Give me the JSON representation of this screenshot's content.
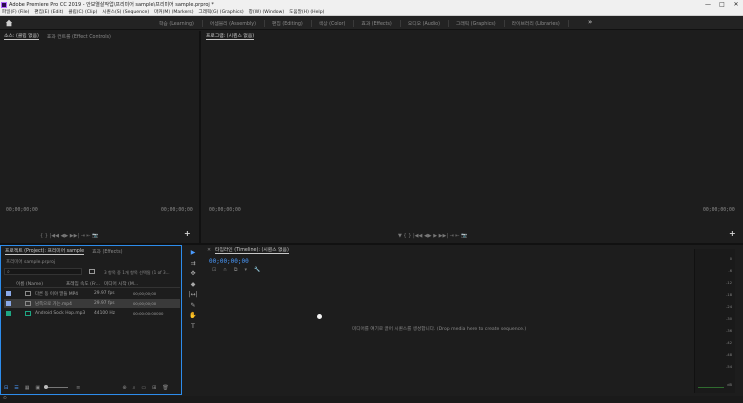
{
  "window": {
    "title": "Adobe Premiere Pro CC 2019 - 안보열살작업\\프리미어 sample\\프리미어 sample.prproj *",
    "controls": [
      "—",
      "□",
      "✕"
    ]
  },
  "menu": [
    "파일(F) (File)",
    "편집(E) (Edit)",
    "클립(C) (Clip)",
    "시퀀스(S) (Sequence)",
    "마커(M) (Markers)",
    "그래픽(G) (Graphics)",
    "창(W) (Window)",
    "도움말(H) (Help)"
  ],
  "workspaces": [
    "학습 (Learning)",
    "어셈블리 (Assembly)",
    "편집 (Editing)",
    "색상 (Color)",
    "효과 (Effects)",
    "오디오 (Audio)",
    "그래픽 (Graphics)",
    "라이브러리 (Libraries)"
  ],
  "workspaces_more": "»",
  "source_panel": {
    "tabs": [
      "소스: (클립 없음)",
      "효과 컨트롤 (Effect Controls)"
    ],
    "timecode_left": "00;00;00;00",
    "timecode_right": "00;00;00;00",
    "fit": "",
    "controls": "{    }    |◀◀  ◀▶  ▶▶|  ⇥   ⇤   📷"
  },
  "program_panel": {
    "tabs": [
      "프로그램: (시퀀스 없음)"
    ],
    "timecode_left": "00;00;00;00",
    "timecode_right": "00;00;00;00",
    "controls": "▼   {    }    |◀◀  ◀▶   ▶   ▶▶|   ⇥   ⇤   📷"
  },
  "project_panel": {
    "tabs": [
      "프로젝트 (Project): 프리미어 sample",
      "효과 (Effects)"
    ],
    "file": "프리미어 sample.prproj",
    "search_placeholder": "",
    "item_count": "3 항목 중 1개 항목 선택됨 (1 of 3...",
    "columns": [
      "이름 (Name)",
      "프레임 속도 (Fr...",
      "미디어 시작 (M..."
    ],
    "rows": [
      {
        "name": "다른 동 이야 말들 MP4",
        "fps": "29.97 fps",
        "start": "00;00;00;00",
        "color": "#8aa9e8",
        "selected": false
      },
      {
        "name": "남쪽으로 가는.mp4",
        "fps": "29.97 fps",
        "start": "00;00;00;00",
        "color": "#8aa9e8",
        "selected": true
      },
      {
        "name": "Android Sock Hop.mp3",
        "fps": "44100 Hz",
        "start": "00:00:00:00000",
        "color": "#1ea683",
        "selected": false
      }
    ]
  },
  "tools": [
    "▶",
    "⇉",
    "✥",
    "◆",
    "|↔|",
    "✎",
    "✋",
    "T"
  ],
  "timeline_panel": {
    "tab": "타임라인 (Timeline): (시퀀스 없음)",
    "timecode": "00;00;00;00",
    "hint": "미디어를 여기로 끌어 시퀀스를 생성합니다. (Drop media here to create sequence.)"
  },
  "meters": {
    "labels": [
      "0",
      "-6",
      "-12",
      "-18",
      "-24",
      "-30",
      "-36",
      "-42",
      "-48",
      "-54",
      "dB"
    ]
  },
  "status": "⊙"
}
